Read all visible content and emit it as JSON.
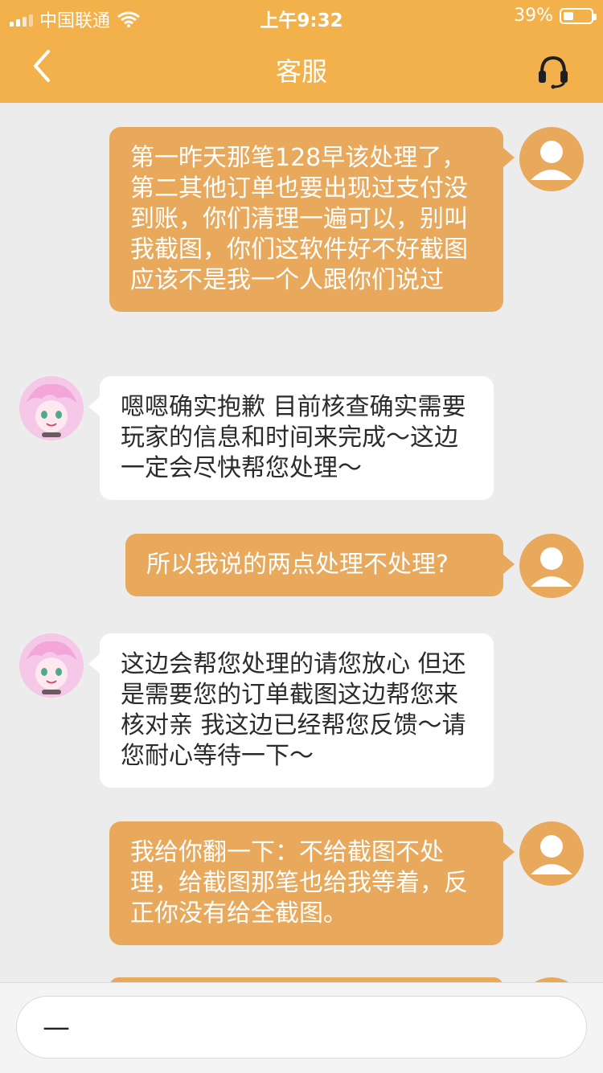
{
  "status_bar": {
    "carrier": "中国联通",
    "time": "上午9:32",
    "battery": "39%"
  },
  "nav": {
    "title": "客服",
    "back_icon": "back-chevron-icon",
    "service_icon": "headset-icon"
  },
  "messages": [
    {
      "side": "right",
      "text": "第一昨天那笔128早该处理了，第二其他订单也要出现过支付没到账，你们清理一遍可以，别叫我截图，你们这软件好不好截图应该不是我一个人跟你们说过"
    },
    {
      "side": "left",
      "text": "嗯嗯确实抱歉 目前核查确实需要玩家的信息和时间来完成～这边一定会尽快帮您处理～"
    },
    {
      "side": "right",
      "text": "所以我说的两点处理不处理?"
    },
    {
      "side": "left",
      "text": "这边会帮您处理的请您放心 但还是需要您的订单截图这边帮您来核对亲 我这边已经帮您反馈～请您耐心等待一下～"
    },
    {
      "side": "right",
      "text": "我给你翻一下：不给截图不处理，给截图那笔也给我等着，反正你没有给全截图。"
    }
  ],
  "composer": {
    "value": "—"
  },
  "colors": {
    "header": "#f2b14b",
    "outgoing_bubble": "#e8a95c",
    "incoming_bubble": "#ffffff",
    "background": "#ececec"
  }
}
